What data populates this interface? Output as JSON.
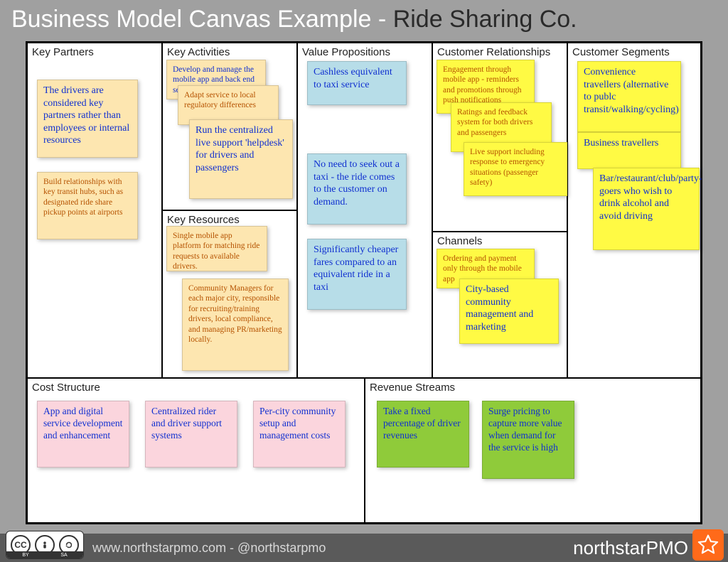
{
  "title": {
    "prefix": "Business Model Canvas Example - ",
    "subject": "Ride Sharing Co."
  },
  "sections": {
    "key_partners": {
      "title": "Key Partners",
      "notes": [
        "The drivers are considered key partners rather than employees or internal resources",
        "Build relationships with key transit hubs, such as designated ride share pickup points at airports"
      ]
    },
    "key_activities": {
      "title": "Key Activities",
      "notes": [
        "Develop and manage the mobile app and back end service",
        "Adapt service to local regulatory differences",
        "Run the centralized live support 'helpdesk' for drivers and passengers"
      ]
    },
    "key_resources": {
      "title": "Key Resources",
      "notes": [
        "Single mobile app platform for matching ride requests to available drivers.",
        "Community Managers for each major city, responsible for recruiting/training drivers, local compliance, and managing PR/marketing locally."
      ]
    },
    "value_propositions": {
      "title": "Value Propositions",
      "notes": [
        "Cashless equivalent to taxi service",
        "No need to seek out a taxi - the ride comes to the customer on demand.",
        "Significantly cheaper fares compared to an equivalent ride in a taxi"
      ]
    },
    "customer_relationships": {
      "title": "Customer Relationships",
      "notes": [
        "Engagement through mobile app - reminders and promotions through push notifications",
        "Ratings and feedback system for both drivers and passengers",
        "Live support including response to emergency situations (passenger safety)"
      ]
    },
    "channels": {
      "title": "Channels",
      "notes": [
        "Ordering and payment only through the mobile app",
        "City-based community management and marketing"
      ]
    },
    "customer_segments": {
      "title": "Customer Segments",
      "notes": [
        "Convenience travellers (alternative to publc transit/walking/cycling)",
        "Business travellers",
        "Bar/restaurant/club/party-goers who wish to drink alcohol and avoid driving"
      ]
    },
    "cost_structure": {
      "title": "Cost Structure",
      "notes": [
        "App and digital service development and enhancement",
        "Centralized rider and driver support systems",
        "Per-city community setup and management costs"
      ]
    },
    "revenue_streams": {
      "title": "Revenue Streams",
      "notes": [
        "Take a fixed percentage of driver revenues",
        "Surge pricing to capture more value when demand for the service is high"
      ]
    }
  },
  "footer": {
    "url": "www.northstarpmo.com - @northstarpmo",
    "brand": "northstarPMO",
    "license_labels": [
      "BY",
      "SA"
    ]
  }
}
